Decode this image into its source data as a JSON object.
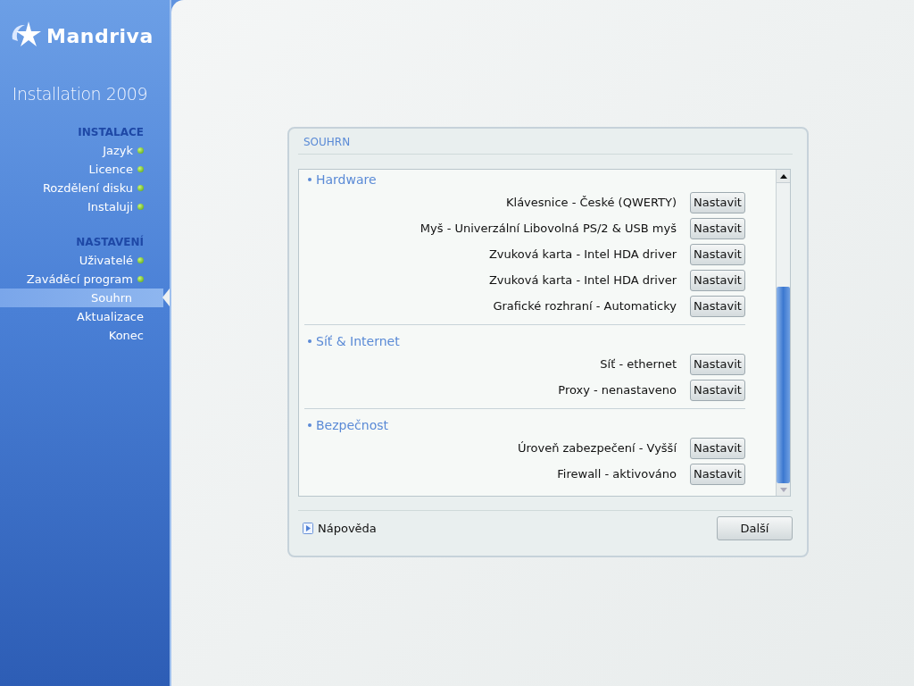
{
  "sidebar": {
    "logo": "Mandriva",
    "subtitle": "Installation 2009",
    "sections": [
      {
        "title": "INSTALACE",
        "items": [
          {
            "label": "Jazyk",
            "done": true,
            "selected": false
          },
          {
            "label": "Licence",
            "done": true,
            "selected": false
          },
          {
            "label": "Rozdělení disku",
            "done": true,
            "selected": false
          },
          {
            "label": "Instaluji",
            "done": true,
            "selected": false
          }
        ]
      },
      {
        "title": "NASTAVENÍ",
        "items": [
          {
            "label": "Uživatelé",
            "done": true,
            "selected": false
          },
          {
            "label": "Zaváděcí program",
            "done": true,
            "selected": false
          },
          {
            "label": "Souhrn",
            "done": false,
            "selected": true
          },
          {
            "label": "Aktualizace",
            "done": false,
            "selected": false
          },
          {
            "label": "Konec",
            "done": false,
            "selected": false
          }
        ]
      }
    ]
  },
  "dialog": {
    "title": "SOUHRN",
    "groups": [
      {
        "title": "Hardware",
        "rows": [
          {
            "label": "Klávesnice - České (QWERTY)",
            "button": "Nastavit"
          },
          {
            "label": "Myš - Univerzální Libovolná PS/2 & USB myš",
            "button": "Nastavit"
          },
          {
            "label": "Zvuková karta - Intel HDA driver",
            "button": "Nastavit"
          },
          {
            "label": "Zvuková karta - Intel HDA driver",
            "button": "Nastavit"
          },
          {
            "label": "Grafické rozhraní - Automaticky",
            "button": "Nastavit"
          }
        ]
      },
      {
        "title": "Síť & Internet",
        "rows": [
          {
            "label": "Síť - ethernet",
            "button": "Nastavit"
          },
          {
            "label": "Proxy - nenastaveno",
            "button": "Nastavit"
          }
        ]
      },
      {
        "title": "Bezpečnost",
        "rows": [
          {
            "label": "Úroveň zabezpečení - Vyšší",
            "button": "Nastavit"
          },
          {
            "label": "Firewall - aktivováno",
            "button": "Nastavit"
          }
        ]
      }
    ],
    "help": "Nápověda",
    "next": "Další"
  }
}
